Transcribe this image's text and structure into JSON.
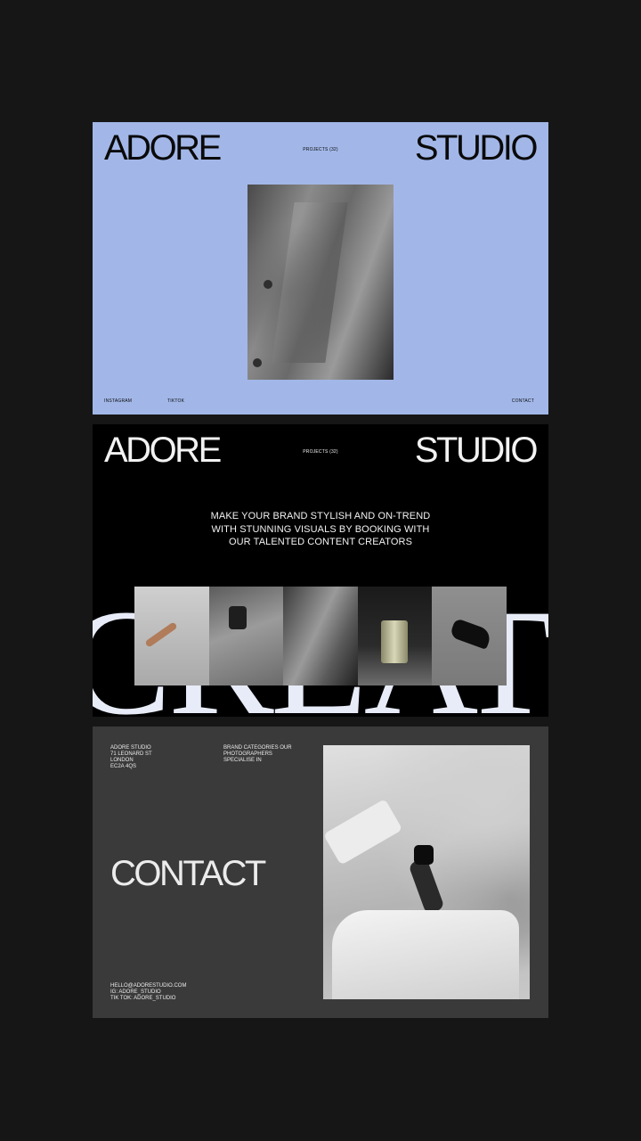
{
  "panel1": {
    "brand_left": "ADORE",
    "brand_right": "STUDIO",
    "projects": "PROJECTS (32)",
    "footer": {
      "instagram": "INSTAGRAM",
      "tiktok": "TIKTOK",
      "contact": "CONTACT"
    },
    "background": "#a2b7e8"
  },
  "panel2": {
    "brand_left": "ADORE",
    "brand_right": "STUDIO",
    "projects": "PROJECTS (32)",
    "tagline": [
      "MAKE YOUR BRAND STYLISH AND ON-TREND",
      "WITH STUNNING VISUALS BY BOOKING WITH",
      "OUR TALENTED CONTENT CREATORS"
    ],
    "background_word": "CREATIVE",
    "background": "#000000"
  },
  "panel3": {
    "address": [
      "ADORE STUDIO",
      "71 LEONARD ST",
      "LONDON",
      "EC2A 4QS"
    ],
    "categories": "BRAND CATEGORIES OUR PHOTOGRAPHERS SPECIALISE IN",
    "title": "CONTACT",
    "contacts": [
      "HELLO@ADORESTUDIO.COM",
      "IG: ADORE_STUDIO",
      "TIK TOK: ADORE_STUDIO"
    ],
    "background": "#3a3a3a"
  }
}
